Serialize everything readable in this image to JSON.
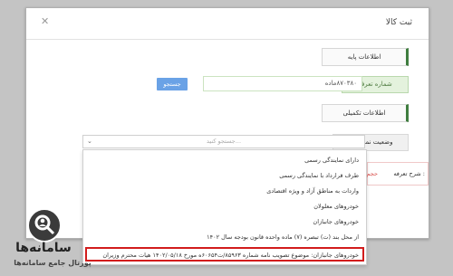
{
  "modal": {
    "title": "ثبت کالا",
    "close_icon": "close-icon"
  },
  "sections": {
    "base_info": "اطلاعات پایه",
    "extra_info": "اطلاعات تکمیلی"
  },
  "form": {
    "tracking_label": "شماره تعرفه",
    "tracking_value": "۸۷۰۳۸۰ماده",
    "search_button": "جستجو",
    "status_label": "وضعیت نمایندگی",
    "status_placeholder": "جستجو کنید...",
    "description_label": "شرح تعرفه :",
    "description_hint": "**** حجم موتور بیـ"
  },
  "dropdown": {
    "items": [
      "دارای نمایندگی رسمی",
      "طرف قرارداد با نمایندگی رسمی",
      "واردات به مناطق آزاد و ویژه اقتصادی",
      "خودروهای معلولان",
      "خودروهای جانبازان",
      "از محل بند (ت) تبصره (۷) ماده واحده قانون بودجه سال ۱۴۰۲",
      "خودروهای جانبازان: موضوع تصویب نامه شماره ۸۵۹۶۳/ت۶۰۶۵۴ه مورخ ۱۴۰۲/۰۵/۱۸ هیات محترم وزیران"
    ],
    "highlighted_index": 6
  },
  "brand": {
    "name": "سامانه‌ها",
    "subtitle": "پورتال جامع سامانه‌ها",
    "icon": "search-person-icon"
  },
  "colors": {
    "accent_green": "#3f7d3f",
    "button_blue": "#6aa2e6",
    "highlight_red": "#d21c1c"
  }
}
